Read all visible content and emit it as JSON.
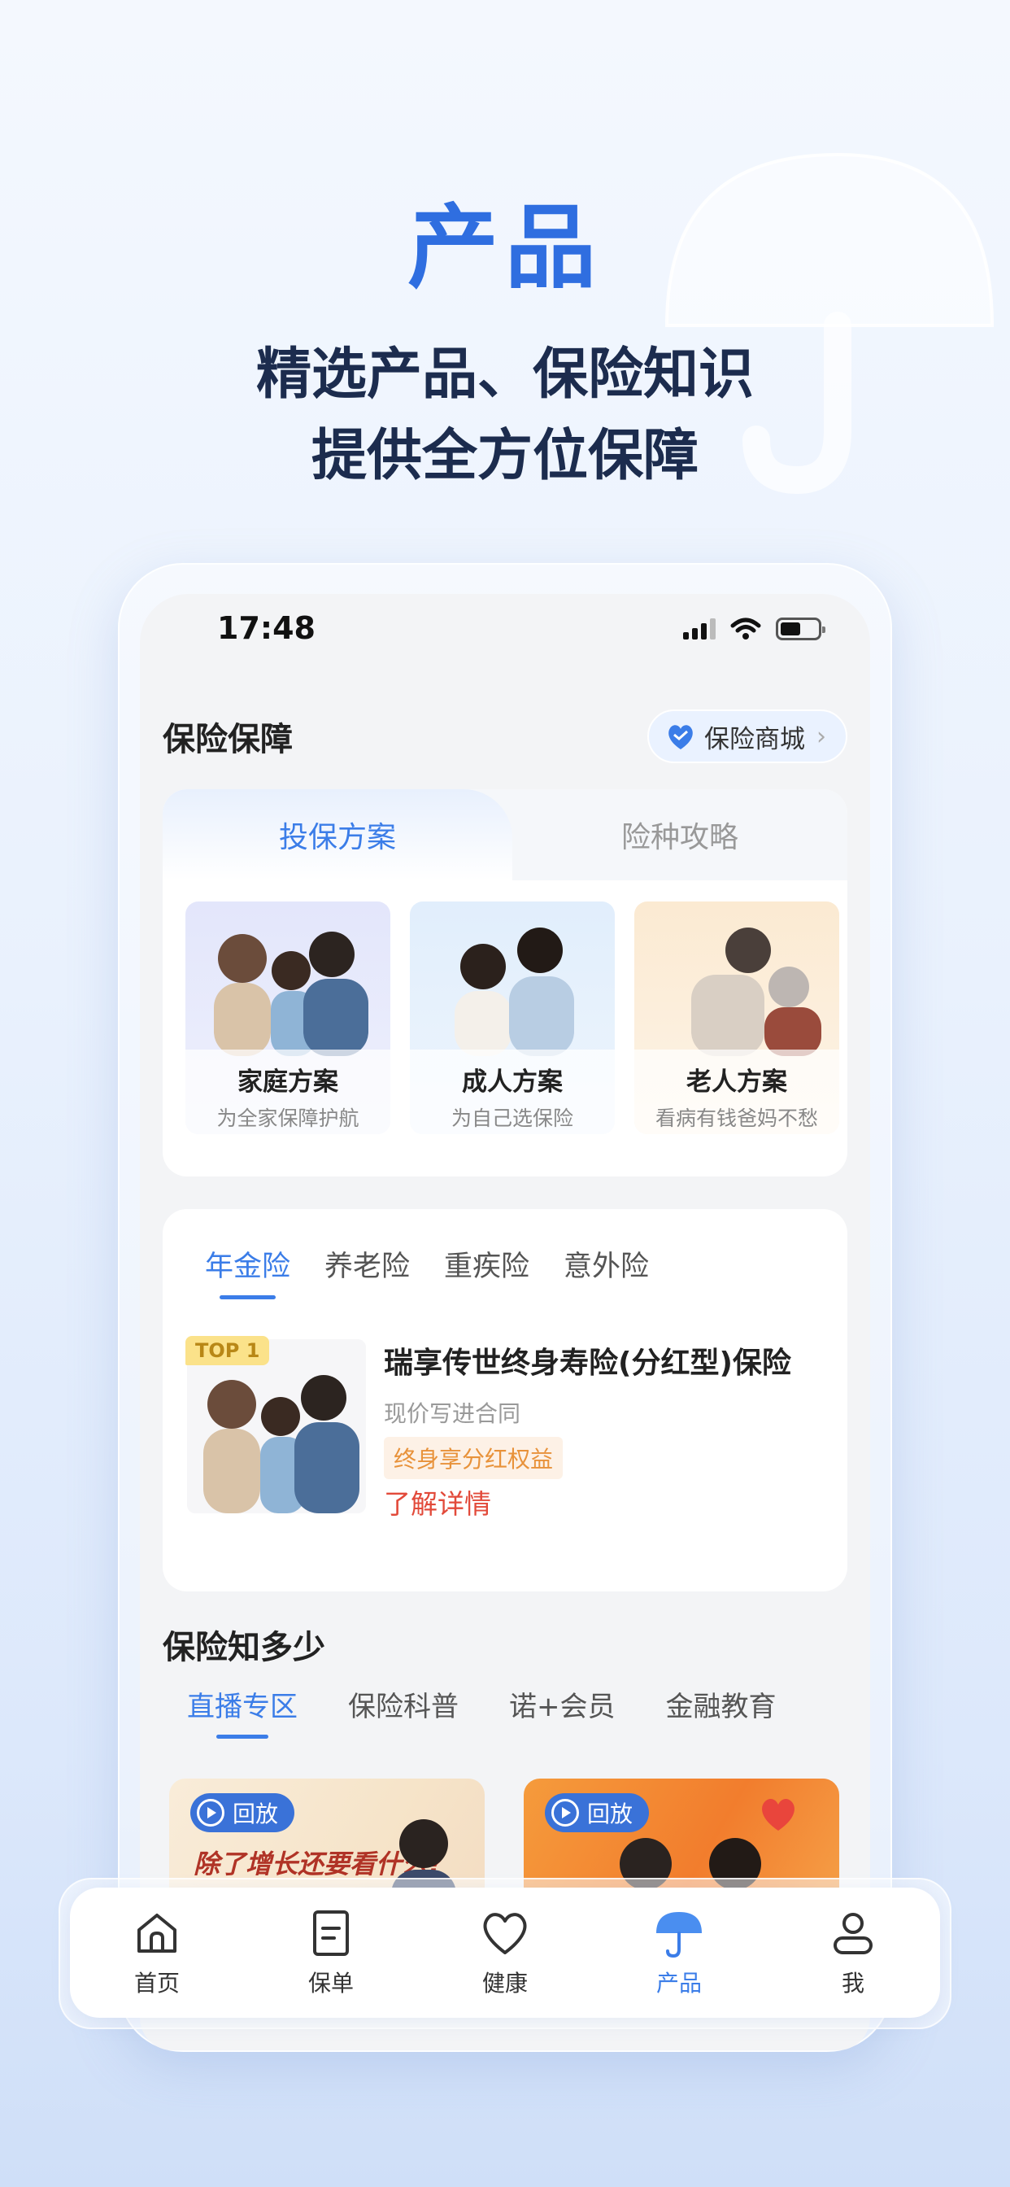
{
  "hero": {
    "title": "产品",
    "subtitle_line1": "精选产品、保险知识",
    "subtitle_line2": "提供全方位保障"
  },
  "status_bar": {
    "time": "17:48"
  },
  "insurance_section": {
    "title": "保险保障",
    "mall_button": "保险商城"
  },
  "plan_tabs": [
    "投保方案",
    "险种攻略"
  ],
  "plans": [
    {
      "name": "家庭方案",
      "desc": "为全家保障护航"
    },
    {
      "name": "成人方案",
      "desc": "为自己选保险"
    },
    {
      "name": "老人方案",
      "desc": "看病有钱爸妈不愁"
    }
  ],
  "product_tabs": [
    "年金险",
    "养老险",
    "重疾险",
    "意外险"
  ],
  "product": {
    "badge": "TOP 1",
    "name": "瑞享传世终身寿险(分红型)保险",
    "subtitle": "现价写进合同",
    "tag": "终身享分红权益",
    "link": "了解详情"
  },
  "knowledge": {
    "title": "保险知多少",
    "tabs": [
      "直播专区",
      "保险科普",
      "诺+会员",
      "金融教育"
    ],
    "live_cards": [
      {
        "badge": "回放",
        "headline": "除了增长还要看什么?"
      },
      {
        "badge": "回放",
        "headline": ""
      }
    ]
  },
  "tabbar": [
    {
      "label": "首页",
      "icon": "home-icon"
    },
    {
      "label": "保单",
      "icon": "policy-icon"
    },
    {
      "label": "健康",
      "icon": "heart-icon"
    },
    {
      "label": "产品",
      "icon": "umbrella-icon"
    },
    {
      "label": "我",
      "icon": "profile-icon"
    }
  ],
  "colors": {
    "accent": "#3b7de8",
    "hero_title": "#2f6ee0",
    "link_red": "#e24a3a",
    "tag_orange": "#e8923a"
  }
}
